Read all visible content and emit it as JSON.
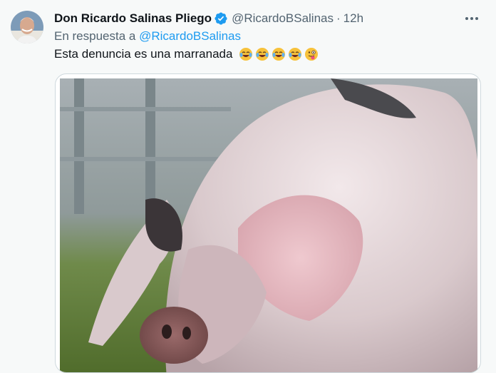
{
  "tweet": {
    "display_name": "Don Ricardo Salinas Pliego",
    "handle": "@RicardoBSalinas",
    "separator": "·",
    "time": "12h",
    "reply_prefix": "En respuesta a ",
    "reply_handle": "@RicardoBSalinas",
    "text": "Esta denuncia es una marranada",
    "emojis": [
      "face-with-tears-of-joy",
      "face-with-tears-of-joy",
      "face-with-tears-of-joy",
      "face-with-tears-of-joy",
      "winking-face-with-tongue"
    ],
    "image_caption": "pig photo"
  },
  "colors": {
    "link": "#1d9bf0",
    "secondary": "#536471",
    "verified": "#1d9bf0",
    "background": "#f7f9f9"
  },
  "icons": [
    "avatar",
    "verified-badge-icon",
    "more-options-icon"
  ]
}
